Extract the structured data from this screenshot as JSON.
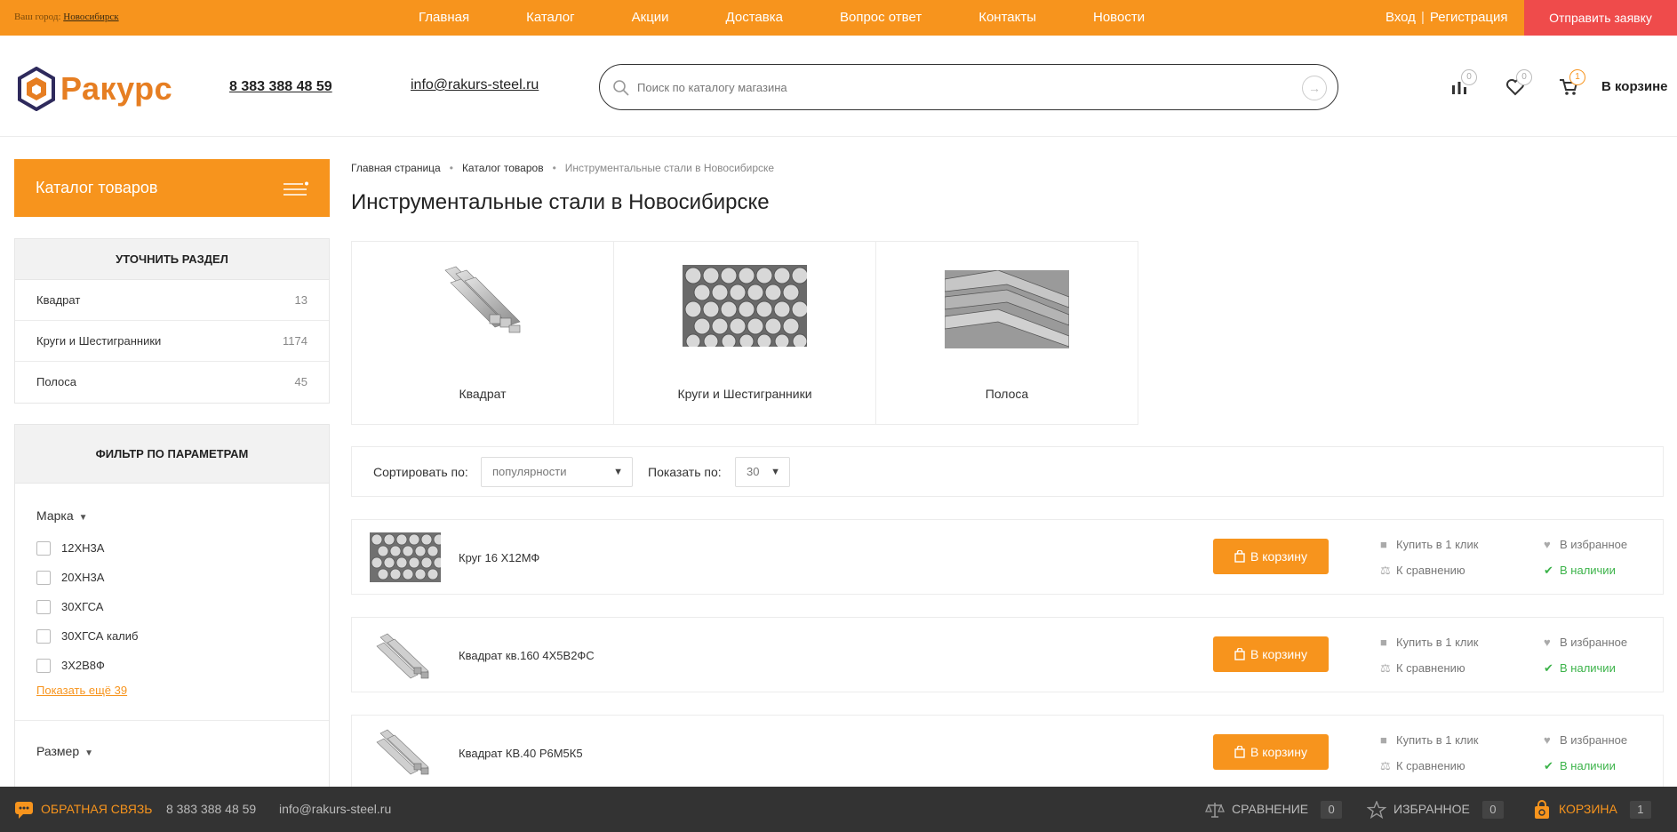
{
  "topbar": {
    "city_prefix": "Ваш город:",
    "city": "Новосибирск",
    "nav": [
      "Главная",
      "Каталог",
      "Акции",
      "Доставка",
      "Вопрос ответ",
      "Контакты",
      "Новости"
    ],
    "login": "Вход",
    "separator": "|",
    "register": "Регистрация",
    "request_button": "Отправить заявку"
  },
  "header": {
    "logo_text": "Ракурс",
    "phone": "8 383 388 48 59",
    "email": "info@rakurs-steel.ru",
    "search_placeholder": "Поиск по каталогу магазина",
    "compare_count": "0",
    "favorites_count": "0",
    "cart_count": "1",
    "cart_label": "В корзине"
  },
  "sidebar": {
    "catalog_button": "Каталог товаров",
    "section_title": "УТОЧНИТЬ РАЗДЕЛ",
    "sections": [
      {
        "name": "Квадрат",
        "count": "13"
      },
      {
        "name": "Круги и Шестигранники",
        "count": "1174"
      },
      {
        "name": "Полоса",
        "count": "45"
      }
    ],
    "filter_title": "ФИЛЬТР ПО ПАРАМЕТРАМ",
    "brand_label": "Марка",
    "brands": [
      "12ХН3А",
      "20ХН3А",
      "30ХГСА",
      "30ХГСА калиб",
      "3Х2В8Ф"
    ],
    "show_more": "Показать ещё 39",
    "size_label": "Размер"
  },
  "main": {
    "breadcrumb": [
      "Главная страница",
      "Каталог товаров",
      "Инструментальные стали в Новосибирске"
    ],
    "title": "Инструментальные стали в Новосибирске",
    "categories": [
      {
        "name": "Квадрат"
      },
      {
        "name": "Круги и Шестигранники"
      },
      {
        "name": "Полоса"
      }
    ],
    "sort_label": "Сортировать по:",
    "sort_value": "популярности",
    "show_label": "Показать по:",
    "show_value": "30",
    "products": [
      {
        "name": "Круг 16 Х12МФ",
        "buy": "В корзину",
        "one_click": "Купить в 1 клик",
        "compare": "К сравнению",
        "favorite": "В избранное",
        "stock": "В наличии"
      },
      {
        "name": "Квадрат кв.160 4Х5В2ФС",
        "buy": "В корзину",
        "one_click": "Купить в 1 клик",
        "compare": "К сравнению",
        "favorite": "В избранное",
        "stock": "В наличии"
      },
      {
        "name": "Квадрат КВ.40 Р6М5К5",
        "buy": "В корзину",
        "one_click": "Купить в 1 клик",
        "compare": "К сравнению",
        "favorite": "В избранное",
        "stock": "В наличии"
      }
    ]
  },
  "footer": {
    "feedback": "ОБРАТНАЯ СВЯЗЬ",
    "phone": "8 383 388 48 59",
    "email": "info@rakurs-steel.ru",
    "compare_label": "СРАВНЕНИЕ",
    "compare_count": "0",
    "favorites_label": "ИЗБРАННОЕ",
    "favorites_count": "0",
    "cart_label": "КОРЗИНА",
    "cart_count": "1"
  },
  "colors": {
    "accent": "#f7941d",
    "request_button": "#ef4b4b",
    "in_stock": "#3cb34a",
    "footer_bg": "#333333"
  }
}
